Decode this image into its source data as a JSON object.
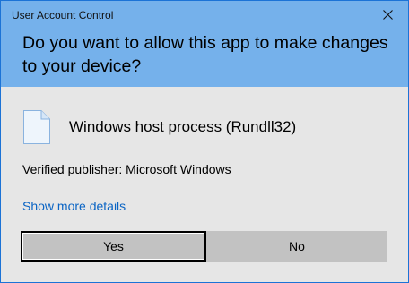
{
  "window": {
    "title": "User Account Control",
    "question": "Do you want to allow this app to make changes to your device?"
  },
  "app": {
    "name": "Windows host process (Rundll32)",
    "icon": "document-file-icon"
  },
  "publisher_text": "Verified publisher: Microsoft Windows",
  "details_link": "Show more details",
  "buttons": {
    "yes": "Yes",
    "no": "No"
  },
  "colors": {
    "header": "#75b1eb",
    "body": "#e6e6e6",
    "link": "#0a64c4",
    "button": "#c2c2c2"
  }
}
